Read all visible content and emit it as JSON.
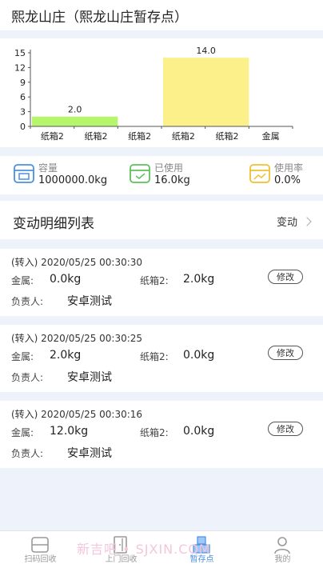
{
  "page": {
    "title": "熙龙山庄（熙龙山庄暂存点）"
  },
  "chart_data": {
    "type": "bar",
    "categories": [
      "纸箱2",
      "纸箱2",
      "纸箱2",
      "纸箱2",
      "纸箱2",
      "金属"
    ],
    "bars": [
      {
        "label": "2.0",
        "value": 2.0,
        "from": 0,
        "to": 2,
        "color": "#b6f56c"
      },
      {
        "label": "14.0",
        "value": 14.0,
        "from": 3,
        "to": 5,
        "color": "#fbf08a"
      }
    ],
    "y_ticks": [
      0,
      3,
      6,
      9,
      12,
      15
    ],
    "ylim": [
      0,
      15
    ],
    "grid": false
  },
  "stats": [
    {
      "label": "容量",
      "value": "1000000.0kg",
      "icon": "storage-capacity-icon",
      "color": "#4a90e2"
    },
    {
      "label": "已使用",
      "value": "16.0kg",
      "icon": "used-box-icon",
      "color": "#5cc15c"
    },
    {
      "label": "使用率",
      "value": "0.0%",
      "icon": "usage-rate-icon",
      "color": "#f0c030"
    }
  ],
  "section": {
    "title": "变动明细列表",
    "filter_label": "变动"
  },
  "records": [
    {
      "time": "(转入) 2020/05/25 00:30:30",
      "k1": "金属:",
      "v1": "0.0kg",
      "k2": "纸箱2:",
      "v2": "2.0kg",
      "person_label": "负责人:",
      "person": "安卓测试",
      "button": "修改"
    },
    {
      "time": "(转入) 2020/05/25 00:30:25",
      "k1": "金属:",
      "v1": "2.0kg",
      "k2": "纸箱2:",
      "v2": "0.0kg",
      "person_label": "负责人:",
      "person": "安卓测试",
      "button": "修改"
    },
    {
      "time": "(转入) 2020/05/25 00:30:16",
      "k1": "金属:",
      "v1": "12.0kg",
      "k2": "纸箱2:",
      "v2": "0.0kg",
      "person_label": "负责人:",
      "person": "安卓测试",
      "button": "修改"
    }
  ],
  "tabs": [
    {
      "label": "扫码回收",
      "icon": "scan-icon",
      "active": false
    },
    {
      "label": "上门回收",
      "icon": "door-icon",
      "active": false
    },
    {
      "label": "暂存点",
      "icon": "storage-point-icon",
      "active": true
    },
    {
      "label": "我的",
      "icon": "person-icon",
      "active": false
    }
  ],
  "watermark": "新吉吧 • SJXIN.COM"
}
